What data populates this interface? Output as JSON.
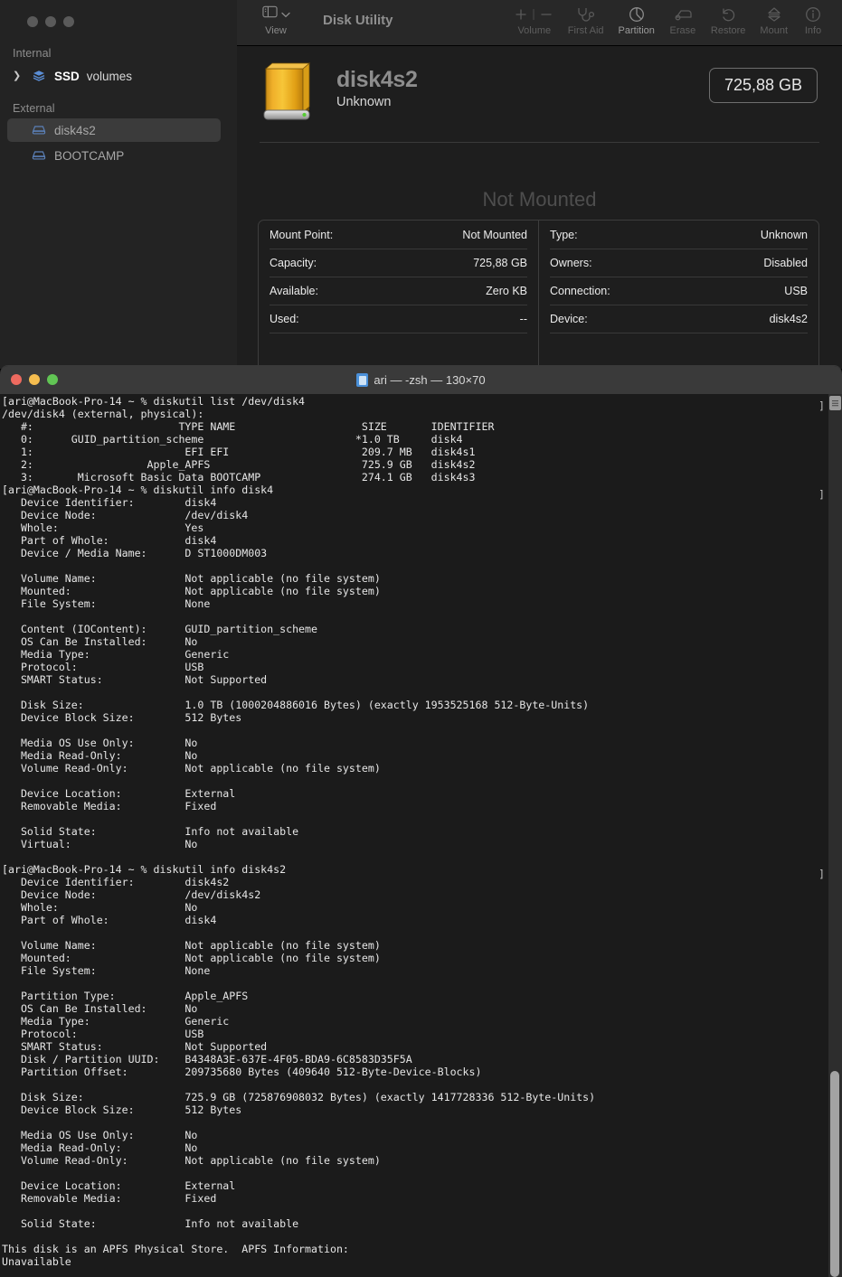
{
  "disk_utility": {
    "window_title": "Disk Utility",
    "toolbar": {
      "view_label": "View",
      "view_icon": "sidebar-icon",
      "view_chevron_icon": "chevron-down-icon",
      "items": [
        {
          "label": "Volume",
          "icon": "plus-minus-icon",
          "enabled": false
        },
        {
          "label": "First Aid",
          "icon": "stethoscope-icon",
          "enabled": false
        },
        {
          "label": "Partition",
          "icon": "pie-chart-icon",
          "enabled": true
        },
        {
          "label": "Erase",
          "icon": "eraser-icon",
          "enabled": false
        },
        {
          "label": "Restore",
          "icon": "undo-arrow-icon",
          "enabled": false
        },
        {
          "label": "Mount",
          "icon": "eject-icon",
          "enabled": false
        },
        {
          "label": "Info",
          "icon": "info-circle-icon",
          "enabled": false
        }
      ]
    },
    "sidebar": {
      "groups": [
        {
          "title": "Internal",
          "items": [
            {
              "name": "SSD",
              "suffix": "volumes",
              "icon": "layers-icon",
              "expandable": true,
              "selected": false
            }
          ]
        },
        {
          "title": "External",
          "items": [
            {
              "name": "disk4s2",
              "suffix": "",
              "icon": "drive-icon",
              "expandable": false,
              "selected": true
            },
            {
              "name": "BOOTCAMP",
              "suffix": "",
              "icon": "drive-icon",
              "expandable": false,
              "selected": false
            }
          ]
        }
      ]
    },
    "hero": {
      "icon": "external-hard-drive-icon",
      "name": "disk4s2",
      "subtitle": "Unknown",
      "capacity_badge": "725,88 GB"
    },
    "status_text": "Not Mounted",
    "info_left": [
      {
        "key": "Mount Point:",
        "value": "Not Mounted"
      },
      {
        "key": "Capacity:",
        "value": "725,88 GB"
      },
      {
        "key": "Available:",
        "value": "Zero KB"
      },
      {
        "key": "Used:",
        "value": "--"
      }
    ],
    "info_right": [
      {
        "key": "Type:",
        "value": "Unknown"
      },
      {
        "key": "Owners:",
        "value": "Disabled"
      },
      {
        "key": "Connection:",
        "value": "USB"
      },
      {
        "key": "Device:",
        "value": "disk4s2"
      }
    ]
  },
  "terminal": {
    "title": "ari — -zsh — 130×70",
    "title_icon": "terminal-folder-icon",
    "traffic_colors": {
      "close": "#ee6a5f",
      "minimize": "#f5bd4f",
      "zoom": "#61c554"
    },
    "gutter_marks": [
      "]",
      "]",
      "]"
    ],
    "content": "[ari@MacBook-Pro-14 ~ % diskutil list /dev/disk4\n/dev/disk4 (external, physical):\n   #:                       TYPE NAME                    SIZE       IDENTIFIER\n   0:      GUID_partition_scheme                        *1.0 TB     disk4\n   1:                        EFI EFI                     209.7 MB   disk4s1\n   2:                  Apple_APFS                        725.9 GB   disk4s2\n   3:       Microsoft Basic Data BOOTCAMP                274.1 GB   disk4s3\n[ari@MacBook-Pro-14 ~ % diskutil info disk4\n   Device Identifier:        disk4\n   Device Node:              /dev/disk4\n   Whole:                    Yes\n   Part of Whole:            disk4\n   Device / Media Name:      D ST1000DM003\n\n   Volume Name:              Not applicable (no file system)\n   Mounted:                  Not applicable (no file system)\n   File System:              None\n\n   Content (IOContent):      GUID_partition_scheme\n   OS Can Be Installed:      No\n   Media Type:               Generic\n   Protocol:                 USB\n   SMART Status:             Not Supported\n\n   Disk Size:                1.0 TB (1000204886016 Bytes) (exactly 1953525168 512-Byte-Units)\n   Device Block Size:        512 Bytes\n\n   Media OS Use Only:        No\n   Media Read-Only:          No\n   Volume Read-Only:         Not applicable (no file system)\n\n   Device Location:          External\n   Removable Media:          Fixed\n\n   Solid State:              Info not available\n   Virtual:                  No\n\n[ari@MacBook-Pro-14 ~ % diskutil info disk4s2\n   Device Identifier:        disk4s2\n   Device Node:              /dev/disk4s2\n   Whole:                    No\n   Part of Whole:            disk4\n\n   Volume Name:              Not applicable (no file system)\n   Mounted:                  Not applicable (no file system)\n   File System:              None\n\n   Partition Type:           Apple_APFS\n   OS Can Be Installed:      No\n   Media Type:               Generic\n   Protocol:                 USB\n   SMART Status:             Not Supported\n   Disk / Partition UUID:    B4348A3E-637E-4F05-BDA9-6C8583D35F5A\n   Partition Offset:         209735680 Bytes (409640 512-Byte-Device-Blocks)\n\n   Disk Size:                725.9 GB (725876908032 Bytes) (exactly 1417728336 512-Byte-Units)\n   Device Block Size:        512 Bytes\n\n   Media OS Use Only:        No\n   Media Read-Only:          No\n   Volume Read-Only:         Not applicable (no file system)\n\n   Device Location:          External\n   Removable Media:          Fixed\n\n   Solid State:              Info not available\n\nThis disk is an APFS Physical Store.  APFS Information:\nUnavailable"
  }
}
